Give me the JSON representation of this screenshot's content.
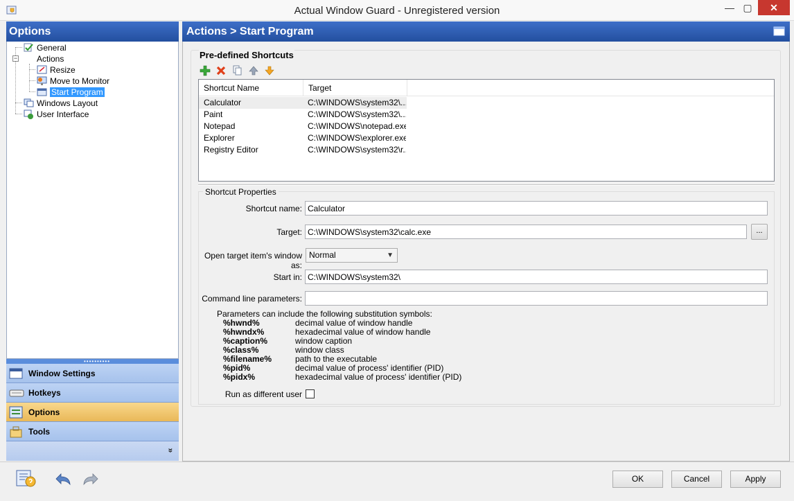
{
  "window": {
    "title": "Actual Window Guard - Unregistered version",
    "min_glyph": "—",
    "max_glyph": "▢",
    "close_glyph": "✕"
  },
  "left_panel": {
    "header": "Options",
    "tree": [
      {
        "label": "General",
        "icon": "general-icon"
      },
      {
        "label": "Actions",
        "icon": "folder-icon",
        "expander": "−"
      },
      {
        "label": "Resize",
        "icon": "resize-icon"
      },
      {
        "label": "Move to Monitor",
        "icon": "monitor-icon"
      },
      {
        "label": "Start Program",
        "icon": "start-program-icon",
        "selected": true
      },
      {
        "label": "Windows Layout",
        "icon": "windows-layout-icon"
      },
      {
        "label": "User Interface",
        "icon": "user-interface-icon"
      }
    ],
    "splitter_glyph": "••••••••••",
    "nav": [
      {
        "label": "Window Settings",
        "icon": "window-settings-icon"
      },
      {
        "label": "Hotkeys",
        "icon": "keyboard-icon"
      },
      {
        "label": "Options",
        "icon": "options-icon",
        "active": true
      },
      {
        "label": "Tools",
        "icon": "tools-icon"
      }
    ],
    "more_glyph": "»"
  },
  "right_panel": {
    "header": "Actions > Start Program",
    "group_title": "Pre-defined Shortcuts",
    "toolbar": [
      "add-icon",
      "delete-icon",
      "copy-icon",
      "move-up-icon",
      "move-down-icon"
    ],
    "list": {
      "columns": [
        "Shortcut Name",
        "Target"
      ],
      "rows": [
        {
          "name": "Calculator",
          "target": "C:\\WINDOWS\\system32\\...",
          "selected": true
        },
        {
          "name": "Paint",
          "target": "C:\\WINDOWS\\system32\\..."
        },
        {
          "name": "Notepad",
          "target": "C:\\WINDOWS\\notepad.exe"
        },
        {
          "name": "Explorer",
          "target": "C:\\WINDOWS\\explorer.exe"
        },
        {
          "name": "Registry Editor",
          "target": "C:\\WINDOWS\\system32\\r..."
        }
      ]
    },
    "properties": {
      "title": "Shortcut Properties",
      "shortcut_name_label": "Shortcut name:",
      "shortcut_name_value": "Calculator",
      "target_label": "Target:",
      "target_value": "C:\\WINDOWS\\system32\\calc.exe",
      "browse_label": "...",
      "open_as_label": "Open target item's window as:",
      "open_as_value": "Normal",
      "open_as_arrow": "▼",
      "start_in_label": "Start in:",
      "start_in_value": "C:\\WINDOWS\\system32\\",
      "cmdline_label": "Command line parameters:",
      "cmdline_value": "",
      "help_intro": "Parameters can include the following substitution symbols:",
      "symbols": [
        {
          "sym": "%hwnd%",
          "desc": "decimal value of window handle"
        },
        {
          "sym": "%hwndx%",
          "desc": "hexadecimal value of window handle"
        },
        {
          "sym": "%caption%",
          "desc": "window caption"
        },
        {
          "sym": "%class%",
          "desc": "window class"
        },
        {
          "sym": "%filename%",
          "desc": "path to the executable"
        },
        {
          "sym": "%pid%",
          "desc": "decimal value of process' identifier (PID)"
        },
        {
          "sym": "%pidx%",
          "desc": "hexadecimal value of process' identifier (PID)"
        }
      ],
      "run_as_label": "Run as different user",
      "run_as_checked": false
    }
  },
  "bottom": {
    "icons": [
      "help-icon",
      "undo-icon",
      "redo-icon"
    ],
    "ok": "OK",
    "cancel": "Cancel",
    "apply": "Apply"
  },
  "colors": {
    "header_blue": "#2a57a8",
    "nav_blue": "#b2cbf1",
    "nav_active": "#f0c46e",
    "selection": "#3399ff",
    "close_red": "#c7372f"
  }
}
